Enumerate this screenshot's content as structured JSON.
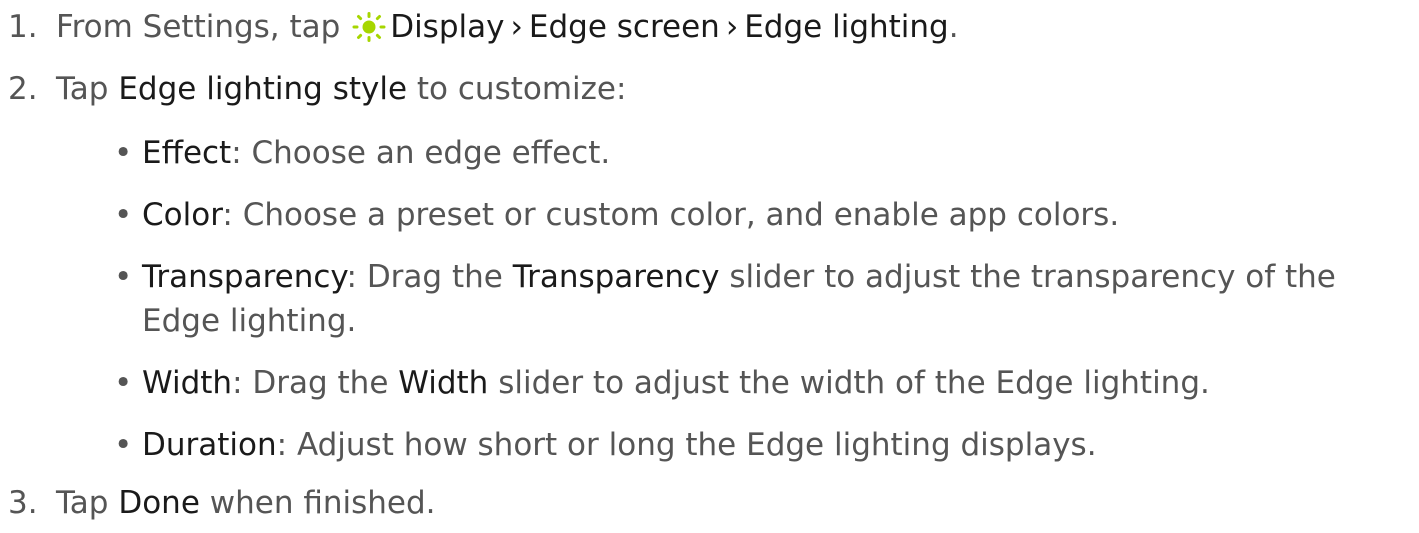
{
  "steps": [
    {
      "number": "1.",
      "intro": "From Settings, tap",
      "icon": "display-sun-icon",
      "icon_color": "#a6d600",
      "path": [
        "Display",
        "Edge screen",
        "Edge lighting"
      ],
      "separator": "›",
      "end": "."
    },
    {
      "number": "2.",
      "pre": "Tap",
      "term": "Edge lighting style",
      "post": "to customize:"
    },
    {
      "number": "3.",
      "pre": "Tap",
      "term": "Done",
      "post": "when finished."
    }
  ],
  "bullet_symbol": "•",
  "options": [
    {
      "term": "Effect",
      "text": ": Choose an edge effect."
    },
    {
      "term": "Color",
      "text": ": Choose a preset or custom color, and enable app colors."
    },
    {
      "term": "Transparency",
      "text_a": ": Drag the",
      "term_b": "Transparency",
      "text_b": "slider to adjust the transparency of the",
      "continuation": "Edge lighting."
    },
    {
      "term": "Width",
      "text_a": ": Drag the",
      "term_b": "Width",
      "text_b": "slider to adjust the width of the Edge lighting."
    },
    {
      "term": "Duration",
      "text": ": Adjust how short or long the Edge lighting displays."
    }
  ]
}
